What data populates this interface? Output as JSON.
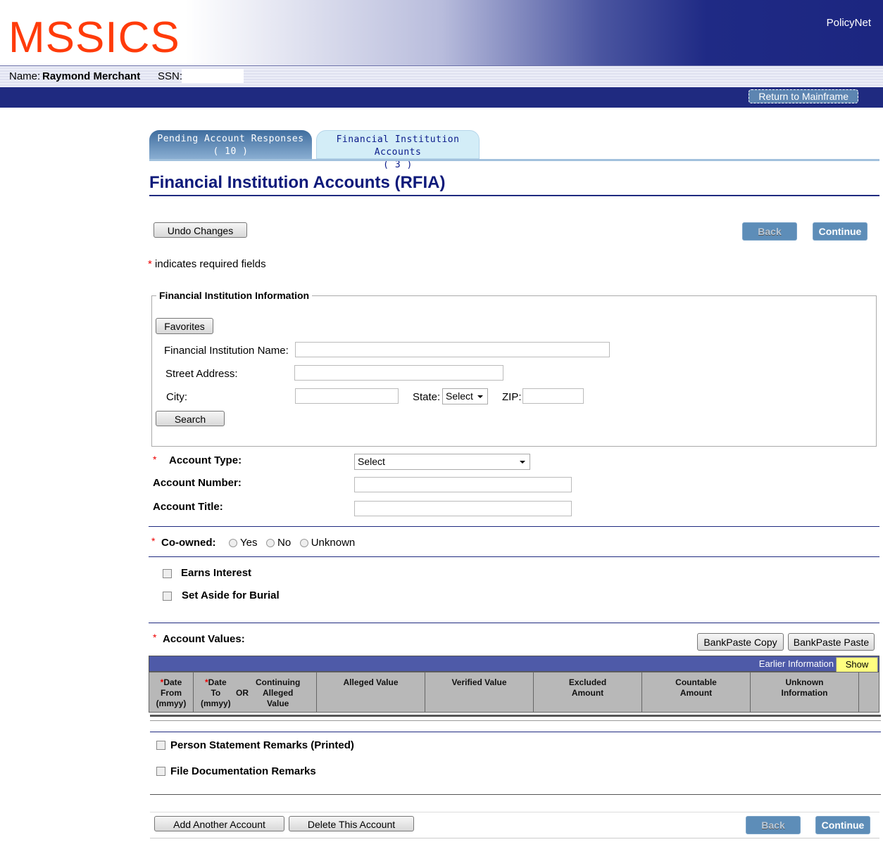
{
  "header": {
    "logo": "MSSICS",
    "policynet": "PolicyNet",
    "name_label": "Name:",
    "name_value": "Raymond Merchant",
    "ssn_label": "SSN:",
    "return_button": "Return to Mainframe"
  },
  "tabs": [
    {
      "label": "Pending Account Responses",
      "count": "( 10 )"
    },
    {
      "label": "Financial Institution Accounts",
      "count": "( 3 )"
    }
  ],
  "page": {
    "title": "Financial Institution Accounts (RFIA)",
    "undo": "Undo Changes",
    "back": "Back",
    "continue": "Continue",
    "required_note": "indicates required fields",
    "asterisk": "*"
  },
  "fi": {
    "legend": "Financial Institution Information",
    "favorites": "Favorites",
    "name_label": "Financial Institution Name:",
    "street_label": "Street Address:",
    "city_label": "City:",
    "state_label": "State:",
    "state_value": "Select",
    "zip_label": "ZIP:",
    "search": "Search"
  },
  "account": {
    "type_label": "Account Type:",
    "type_value": "Select",
    "number_label": "Account Number:",
    "title_label": "Account Title:",
    "coowned_label": "Co-owned:",
    "options": [
      "Yes",
      "No",
      "Unknown"
    ],
    "earns_interest": "Earns Interest",
    "burial": "Set Aside for Burial",
    "values_label": "Account Values:",
    "bankpaste_copy": "BankPaste Copy",
    "bankpaste_paste": "BankPaste Paste"
  },
  "table": {
    "earlier": "Earlier Information",
    "show": "Show",
    "columns": {
      "date_from": [
        "Date",
        "From",
        "(mmyy)"
      ],
      "date_to": [
        "Date",
        "To",
        "(mmyy)"
      ],
      "or": "OR",
      "continuing": [
        "Continuing",
        "Alleged",
        "Value"
      ],
      "alleged": "Alleged Value",
      "verified": "Verified Value",
      "excluded": [
        "Excluded",
        "Amount"
      ],
      "countable": [
        "Countable",
        "Amount"
      ],
      "unknown": [
        "Unknown",
        "Information"
      ]
    }
  },
  "remarks": {
    "statement": "Person Statement Remarks (Printed)",
    "file": "File Documentation Remarks"
  },
  "footer": {
    "add": "Add Another Account",
    "delete": "Delete This Account",
    "back": "Back",
    "continue": "Continue"
  },
  "colors": {
    "navy": "#1f2a80",
    "logo": "#ff3b0a",
    "button_blue": "#5d8db8"
  }
}
